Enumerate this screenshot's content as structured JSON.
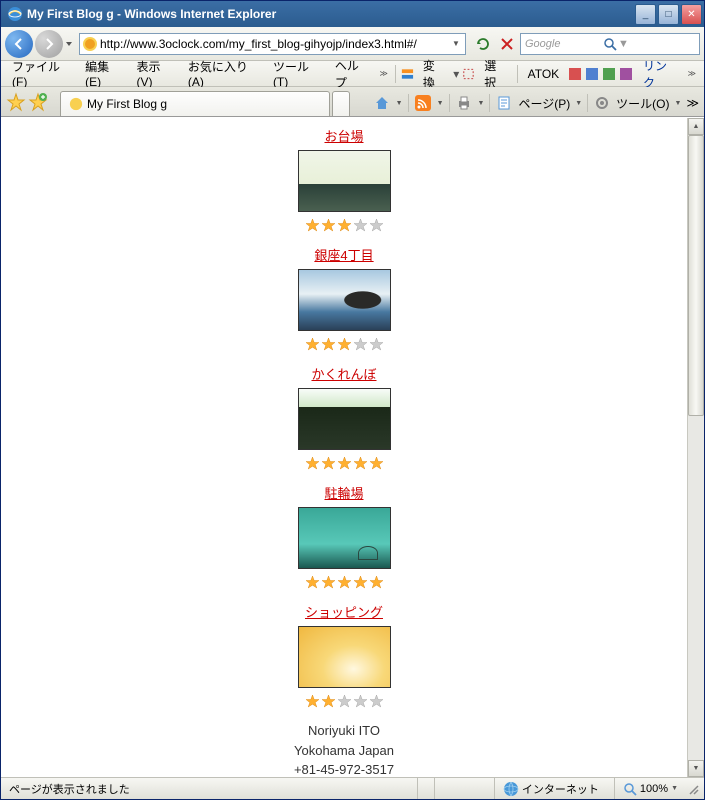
{
  "window": {
    "title": "My First Blog g - Windows Internet Explorer"
  },
  "url": "http://www.3oclock.com/my_first_blog-gihyojp/index3.html#/",
  "search": {
    "placeholder": "Google"
  },
  "menu": {
    "file": "ファイル(F)",
    "edit": "編集(E)",
    "view": "表示(V)",
    "fav": "お気に入り(A)",
    "tools": "ツール(T)",
    "help": "ヘルプ",
    "convert": "変換",
    "select": "選択",
    "atok": "ATOK",
    "links": "リンク"
  },
  "tab": {
    "label": "My First Blog g"
  },
  "cmdbar": {
    "page": "ページ(P)",
    "tools": "ツール(O)"
  },
  "posts": [
    {
      "title": "お台場",
      "thumbClass": "t1",
      "rating": 3
    },
    {
      "title": "銀座4丁目",
      "thumbClass": "t2",
      "rating": 3
    },
    {
      "title": "かくれんぼ",
      "thumbClass": "t3",
      "rating": 5
    },
    {
      "title": "駐輪場",
      "thumbClass": "t4",
      "rating": 5
    },
    {
      "title": "ショッピング",
      "thumbClass": "t5",
      "rating": 2
    }
  ],
  "footer": {
    "name": "Noriyuki ITO",
    "loc": "Yokohama Japan",
    "tel": "+81-45-972-3517"
  },
  "status": {
    "msg": "ページが表示されました",
    "zone": "インターネット",
    "zoom": "100%"
  }
}
